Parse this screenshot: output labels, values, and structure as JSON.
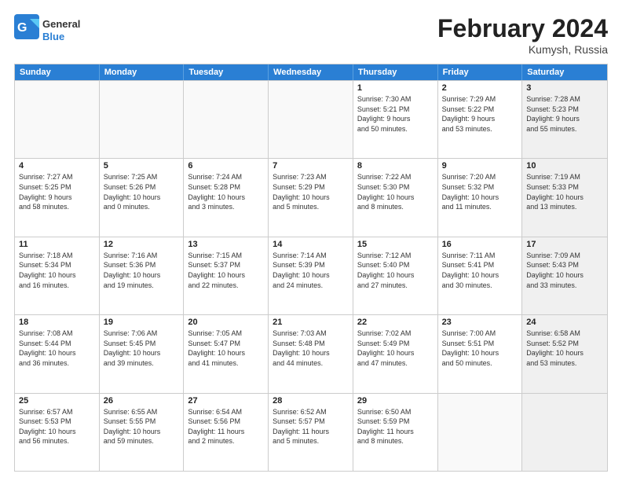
{
  "header": {
    "logo_general": "General",
    "logo_blue": "Blue",
    "month_title": "February 2024",
    "location": "Kumysh, Russia"
  },
  "days_of_week": [
    "Sunday",
    "Monday",
    "Tuesday",
    "Wednesday",
    "Thursday",
    "Friday",
    "Saturday"
  ],
  "rows": [
    [
      {
        "day": "",
        "info": "",
        "empty": true
      },
      {
        "day": "",
        "info": "",
        "empty": true
      },
      {
        "day": "",
        "info": "",
        "empty": true
      },
      {
        "day": "",
        "info": "",
        "empty": true
      },
      {
        "day": "1",
        "info": "Sunrise: 7:30 AM\nSunset: 5:21 PM\nDaylight: 9 hours\nand 50 minutes."
      },
      {
        "day": "2",
        "info": "Sunrise: 7:29 AM\nSunset: 5:22 PM\nDaylight: 9 hours\nand 53 minutes."
      },
      {
        "day": "3",
        "info": "Sunrise: 7:28 AM\nSunset: 5:23 PM\nDaylight: 9 hours\nand 55 minutes.",
        "shaded": true
      }
    ],
    [
      {
        "day": "4",
        "info": "Sunrise: 7:27 AM\nSunset: 5:25 PM\nDaylight: 9 hours\nand 58 minutes."
      },
      {
        "day": "5",
        "info": "Sunrise: 7:25 AM\nSunset: 5:26 PM\nDaylight: 10 hours\nand 0 minutes."
      },
      {
        "day": "6",
        "info": "Sunrise: 7:24 AM\nSunset: 5:28 PM\nDaylight: 10 hours\nand 3 minutes."
      },
      {
        "day": "7",
        "info": "Sunrise: 7:23 AM\nSunset: 5:29 PM\nDaylight: 10 hours\nand 5 minutes."
      },
      {
        "day": "8",
        "info": "Sunrise: 7:22 AM\nSunset: 5:30 PM\nDaylight: 10 hours\nand 8 minutes."
      },
      {
        "day": "9",
        "info": "Sunrise: 7:20 AM\nSunset: 5:32 PM\nDaylight: 10 hours\nand 11 minutes."
      },
      {
        "day": "10",
        "info": "Sunrise: 7:19 AM\nSunset: 5:33 PM\nDaylight: 10 hours\nand 13 minutes.",
        "shaded": true
      }
    ],
    [
      {
        "day": "11",
        "info": "Sunrise: 7:18 AM\nSunset: 5:34 PM\nDaylight: 10 hours\nand 16 minutes."
      },
      {
        "day": "12",
        "info": "Sunrise: 7:16 AM\nSunset: 5:36 PM\nDaylight: 10 hours\nand 19 minutes."
      },
      {
        "day": "13",
        "info": "Sunrise: 7:15 AM\nSunset: 5:37 PM\nDaylight: 10 hours\nand 22 minutes."
      },
      {
        "day": "14",
        "info": "Sunrise: 7:14 AM\nSunset: 5:39 PM\nDaylight: 10 hours\nand 24 minutes."
      },
      {
        "day": "15",
        "info": "Sunrise: 7:12 AM\nSunset: 5:40 PM\nDaylight: 10 hours\nand 27 minutes."
      },
      {
        "day": "16",
        "info": "Sunrise: 7:11 AM\nSunset: 5:41 PM\nDaylight: 10 hours\nand 30 minutes."
      },
      {
        "day": "17",
        "info": "Sunrise: 7:09 AM\nSunset: 5:43 PM\nDaylight: 10 hours\nand 33 minutes.",
        "shaded": true
      }
    ],
    [
      {
        "day": "18",
        "info": "Sunrise: 7:08 AM\nSunset: 5:44 PM\nDaylight: 10 hours\nand 36 minutes."
      },
      {
        "day": "19",
        "info": "Sunrise: 7:06 AM\nSunset: 5:45 PM\nDaylight: 10 hours\nand 39 minutes."
      },
      {
        "day": "20",
        "info": "Sunrise: 7:05 AM\nSunset: 5:47 PM\nDaylight: 10 hours\nand 41 minutes."
      },
      {
        "day": "21",
        "info": "Sunrise: 7:03 AM\nSunset: 5:48 PM\nDaylight: 10 hours\nand 44 minutes."
      },
      {
        "day": "22",
        "info": "Sunrise: 7:02 AM\nSunset: 5:49 PM\nDaylight: 10 hours\nand 47 minutes."
      },
      {
        "day": "23",
        "info": "Sunrise: 7:00 AM\nSunset: 5:51 PM\nDaylight: 10 hours\nand 50 minutes."
      },
      {
        "day": "24",
        "info": "Sunrise: 6:58 AM\nSunset: 5:52 PM\nDaylight: 10 hours\nand 53 minutes.",
        "shaded": true
      }
    ],
    [
      {
        "day": "25",
        "info": "Sunrise: 6:57 AM\nSunset: 5:53 PM\nDaylight: 10 hours\nand 56 minutes."
      },
      {
        "day": "26",
        "info": "Sunrise: 6:55 AM\nSunset: 5:55 PM\nDaylight: 10 hours\nand 59 minutes."
      },
      {
        "day": "27",
        "info": "Sunrise: 6:54 AM\nSunset: 5:56 PM\nDaylight: 11 hours\nand 2 minutes."
      },
      {
        "day": "28",
        "info": "Sunrise: 6:52 AM\nSunset: 5:57 PM\nDaylight: 11 hours\nand 5 minutes."
      },
      {
        "day": "29",
        "info": "Sunrise: 6:50 AM\nSunset: 5:59 PM\nDaylight: 11 hours\nand 8 minutes."
      },
      {
        "day": "",
        "info": "",
        "empty": true
      },
      {
        "day": "",
        "info": "",
        "empty": true,
        "shaded": true
      }
    ]
  ]
}
